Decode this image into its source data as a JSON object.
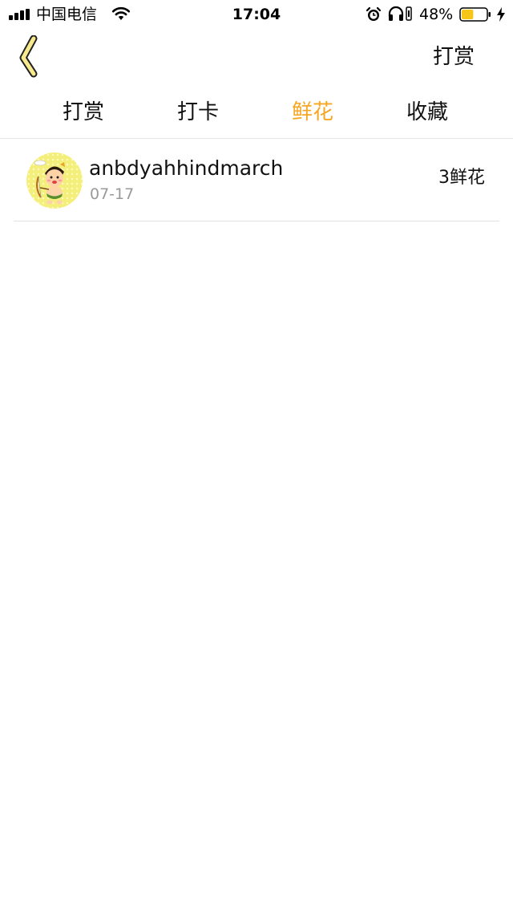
{
  "status_bar": {
    "carrier": "中国电信",
    "time": "17:04",
    "battery_percent": "48%",
    "battery_level": 0.48,
    "icons": [
      "signal-icon",
      "wifi-icon",
      "alarm-icon",
      "headphones-icon",
      "orientation-lock-icon",
      "battery-icon",
      "charging-icon"
    ]
  },
  "nav": {
    "back_icon": "chevron-left-icon",
    "action_label": "打赏"
  },
  "tabs": [
    {
      "label": "打赏",
      "active": false
    },
    {
      "label": "打卡",
      "active": false
    },
    {
      "label": "鲜花",
      "active": true
    },
    {
      "label": "收藏",
      "active": false
    }
  ],
  "list": [
    {
      "name": "anbdyahhindmarch",
      "date": "07-17",
      "amount": "3鲜花",
      "avatar": "cartoon-avatar"
    }
  ],
  "colors": {
    "accent": "#f5a623",
    "text": "#111111",
    "muted": "#9a9a9a",
    "divider": "#e2e2e2",
    "back_fill": "#f7e98d"
  }
}
